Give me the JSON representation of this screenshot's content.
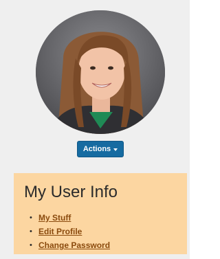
{
  "profile": {
    "avatar_icon": "user-photo",
    "actions_button": {
      "label": "Actions",
      "icon": "caret-down-icon"
    }
  },
  "info_box": {
    "title": "My User Info",
    "links": [
      {
        "label": "My Stuff"
      },
      {
        "label": "Edit Profile"
      },
      {
        "label": "Change Password"
      }
    ]
  },
  "colors": {
    "panel_bg": "#efefef",
    "button_bg": "#166ba1",
    "info_bg": "#fcd6a1",
    "link_color": "#8a4a0d"
  }
}
